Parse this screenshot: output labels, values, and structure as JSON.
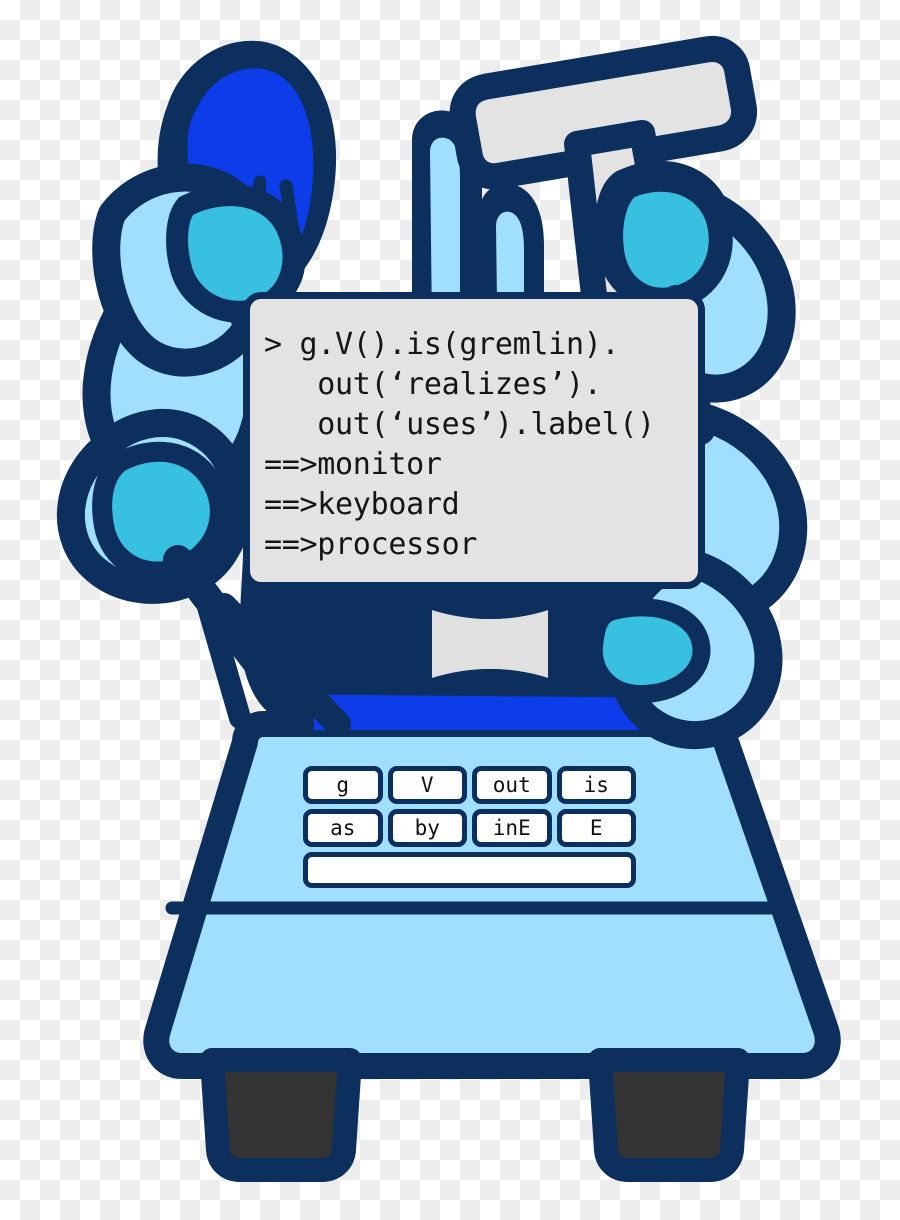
{
  "figure": {
    "name": "gremlin-mascot",
    "description": "Apache TinkerPop Gremlin mascot robot holding a terminal console",
    "palette": {
      "navy_outline": "#0c2f5e",
      "body_light_blue": "#a0dfff",
      "accent_cyan": "#38c0e0",
      "bright_blue": "#0d3de8",
      "console_bg": "#e3e3e3",
      "console_text": "#151515",
      "gold": "#e0b420",
      "foot_dark": "#333333",
      "key_white": "#ffffff",
      "checker_light": "#ededed",
      "checker_white": "#ffffff"
    }
  },
  "console": {
    "name": "gremlin-console",
    "lines": [
      "> g.V().is(gremlin).",
      "   out(‘realizes’).",
      "   out(‘uses’).label()",
      "==>monitor",
      "==>keyboard",
      "==>processor"
    ],
    "prompt": ">",
    "results": [
      "monitor",
      "keyboard",
      "processor"
    ]
  },
  "keyboard": {
    "name": "gremlin-keyboard",
    "rows": [
      {
        "keys": [
          "g",
          "V",
          "out",
          "is"
        ]
      },
      {
        "keys": [
          "as",
          "by",
          "inE",
          "E"
        ]
      },
      {
        "keys": [
          ""
        ]
      }
    ]
  }
}
